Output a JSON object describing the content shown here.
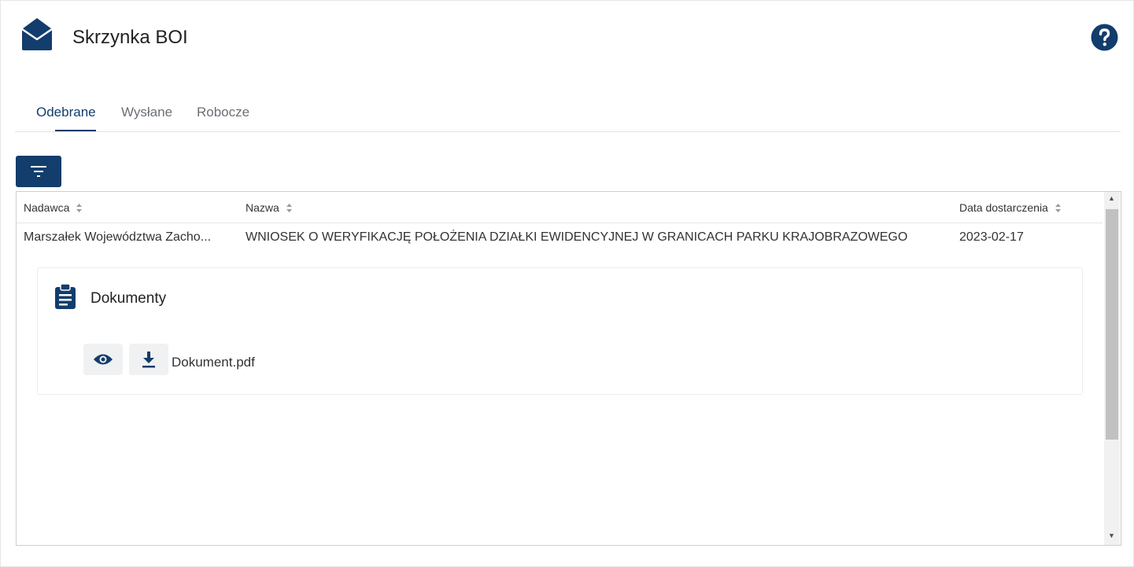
{
  "header": {
    "title": "Skrzynka BOI",
    "icon": "envelope-open-icon",
    "help_icon": "question-circle-icon"
  },
  "tabs": [
    {
      "label": "Odebrane",
      "active": true
    },
    {
      "label": "Wysłane",
      "active": false
    },
    {
      "label": "Robocze",
      "active": false
    }
  ],
  "toolbar": {
    "filter_icon": "filter-icon"
  },
  "table": {
    "columns": [
      "Nadawca",
      "Nazwa",
      "Data dostarczenia"
    ],
    "rows": [
      {
        "sender": "Marszałek Województwa Zacho...",
        "name": "WNIOSEK O WERYFIKACJĘ POŁOŻENIA DZIAŁKI EWIDENCYJNEJ W GRANICACH PARKU KRAJOBRAZOWEGO",
        "date": "2023-02-17"
      }
    ]
  },
  "documents": {
    "title": "Dokumenty",
    "icon": "clipboard-list-icon",
    "files": [
      {
        "name": "Dokument.pdf",
        "preview_icon": "eye-icon",
        "download_icon": "download-icon"
      }
    ]
  },
  "colors": {
    "primary": "#123d6c",
    "tab_inactive": "#6a6f76",
    "button_bg": "#f0f1f2"
  }
}
